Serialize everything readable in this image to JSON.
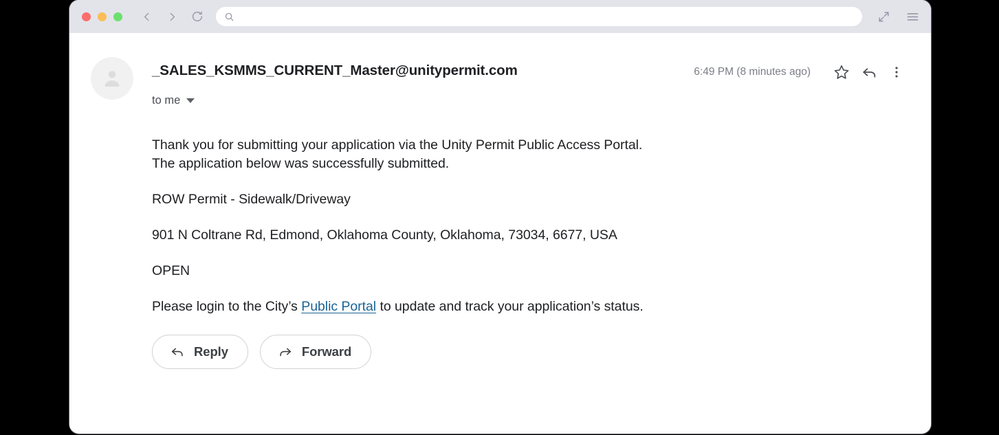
{
  "browser": {
    "traffic_lights": [
      {
        "name": "close",
        "color": "#fb6e6c"
      },
      {
        "name": "minimize",
        "color": "#fbbd55"
      },
      {
        "name": "zoom",
        "color": "#6ce06c"
      }
    ],
    "nav": {
      "back_label": "Back",
      "forward_label": "Forward",
      "reload_label": "Reload"
    },
    "search": {
      "value": "",
      "placeholder": ""
    },
    "right_controls": {
      "expand_label": "Expand",
      "menu_label": "Menu"
    }
  },
  "email": {
    "sender": "_SALES_KSMMS_CURRENT_Master@unitypermit.com",
    "recipients_label": "to me",
    "timestamp": "6:49 PM (8 minutes ago)",
    "header_actions": {
      "star_label": "Star",
      "reply_label": "Reply",
      "more_label": "More options"
    },
    "body": {
      "intro_line_1": "Thank you for submitting your application via the Unity Permit Public Access Portal.",
      "intro_line_2": "The application below was successfully submitted.",
      "permit_type": "ROW Permit - Sidewalk/Driveway",
      "address": "901 N Coltrane Rd, Edmond, Oklahoma County, Oklahoma, 73034, 6677, USA",
      "status": "OPEN",
      "closing_prefix": "Please login to the City’s ",
      "link_text": "Public Portal",
      "closing_suffix": " to update and track your application’s status."
    },
    "footer_buttons": {
      "reply": "Reply",
      "forward": "Forward"
    }
  },
  "colors": {
    "toolbar_bg": "#e3e4ea",
    "link": "#1a6496",
    "text": "#202124",
    "muted_text": "#7b7e85",
    "page_bg": "#ffffff",
    "backdrop": "#000000"
  }
}
